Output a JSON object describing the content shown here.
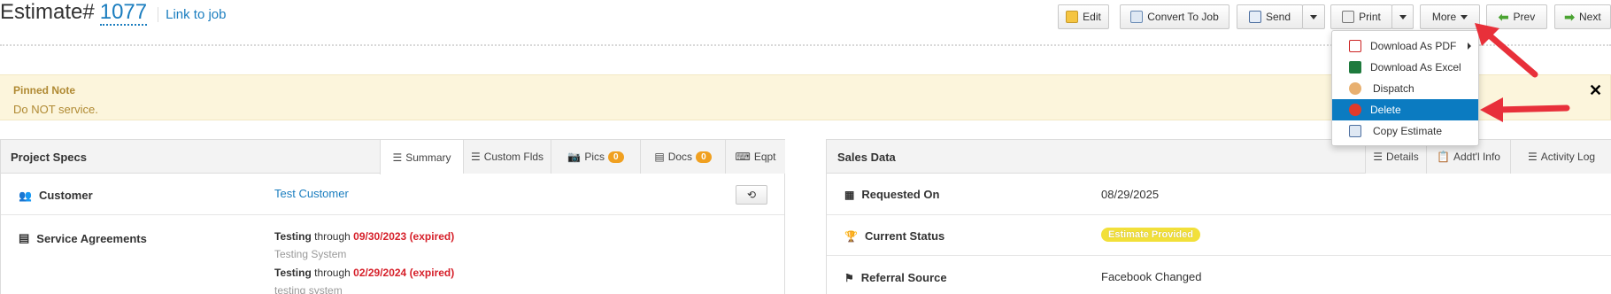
{
  "header": {
    "title_prefix": "Estimate#",
    "estimate_number": "1077",
    "link_to_job": "Link to job"
  },
  "toolbar": {
    "edit": "Edit",
    "convert": "Convert To Job",
    "send": "Send",
    "print": "Print",
    "more": "More",
    "prev": "Prev",
    "next": "Next"
  },
  "more_menu": {
    "items": [
      {
        "label": "Download As PDF",
        "icon": "pdf-icon",
        "has_submenu": true
      },
      {
        "label": "Download As Excel",
        "icon": "excel-icon"
      },
      {
        "label": "Dispatch",
        "icon": "person-icon"
      },
      {
        "label": "Delete",
        "icon": "delete-icon",
        "highlighted": true
      },
      {
        "label": "Copy Estimate",
        "icon": "copy-icon"
      }
    ]
  },
  "pinned_note": {
    "title": "Pinned Note",
    "text": "Do NOT service."
  },
  "project_specs": {
    "title": "Project Specs",
    "tabs": [
      "Summary",
      "Custom Flds",
      "Pics",
      "Docs",
      "Eqpt"
    ],
    "pics_count": "0",
    "docs_count": "0",
    "customer_label": "Customer",
    "customer_value": "Test Customer",
    "service_agreements_label": "Service Agreements",
    "agreements": [
      {
        "name": "Testing",
        "through": "through",
        "date": "09/30/2023 (expired)",
        "subtitle": "Testing System"
      },
      {
        "name": "Testing",
        "through": "through",
        "date": "02/29/2024 (expired)",
        "subtitle": "testing system"
      }
    ]
  },
  "sales_data": {
    "title": "Sales Data",
    "tabs": [
      "Details",
      "Addt'l Info",
      "Activity Log"
    ],
    "requested_on_label": "Requested On",
    "requested_on_value": "08/29/2025",
    "current_status_label": "Current Status",
    "current_status_value": "Estimate Provided",
    "referral_source_label": "Referral Source",
    "referral_source_value": "Facebook Changed"
  },
  "colors": {
    "link": "#1a7dbf",
    "expired": "#d6202a",
    "status_badge": "#f2e03a",
    "menu_highlight": "#0b7bc1",
    "annotation_arrow": "#e8303a",
    "note_bg": "#fcf5dc"
  }
}
